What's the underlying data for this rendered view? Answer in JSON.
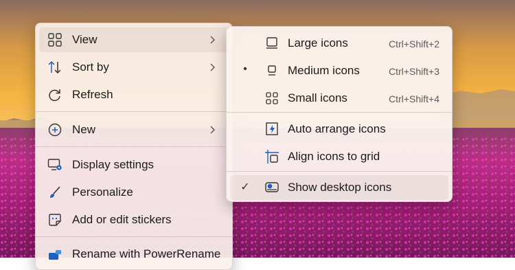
{
  "context_menu": {
    "items": [
      {
        "label": "View",
        "icon": "grid-icon"
      },
      {
        "label": "Sort by",
        "icon": "sort-arrows-icon"
      },
      {
        "label": "Refresh",
        "icon": "refresh-icon"
      },
      {
        "label": "New",
        "icon": "plus-circle-icon"
      },
      {
        "label": "Display settings",
        "icon": "monitor-settings-icon"
      },
      {
        "label": "Personalize",
        "icon": "brush-icon"
      },
      {
        "label": "Add or edit stickers",
        "icon": "sticker-icon"
      },
      {
        "label": "Rename with PowerRename",
        "icon": "powerrename-icon"
      }
    ]
  },
  "view_submenu": {
    "items": [
      {
        "label": "Large icons",
        "shortcut": "Ctrl+Shift+2",
        "icon": "large-icons-icon"
      },
      {
        "label": "Medium icons",
        "shortcut": "Ctrl+Shift+3",
        "icon": "medium-icons-icon",
        "mark": "•"
      },
      {
        "label": "Small icons",
        "shortcut": "Ctrl+Shift+4",
        "icon": "small-icons-icon"
      },
      {
        "label": "Auto arrange icons",
        "icon": "auto-arrange-icon"
      },
      {
        "label": "Align icons to grid",
        "icon": "align-grid-icon"
      },
      {
        "label": "Show desktop icons",
        "icon": "show-desktop-icon",
        "mark": "✓"
      }
    ]
  },
  "colors": {
    "accent": "#1f5fbf",
    "sky_top": "#8a6a62",
    "sky_glow": "#f6b441",
    "flowers": "#b1207f"
  }
}
